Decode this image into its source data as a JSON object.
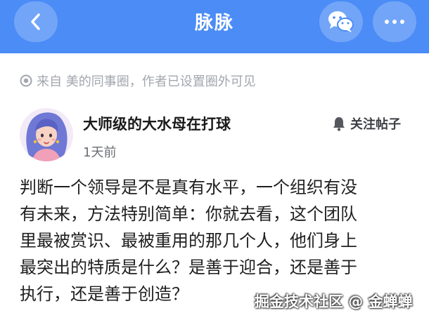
{
  "header": {
    "title": "脉脉",
    "bg_color": "#4b8cf6",
    "back_icon": "chevron-left-icon",
    "share_icon": "wechat-icon",
    "more_icon": "more-dots-icon"
  },
  "source": {
    "icon": "circle-dot-icon",
    "text": "来自 美的同事圈，作者已设置圈外可见"
  },
  "author": {
    "avatar_icon": "avatar",
    "name": "大师级的大水母在打球",
    "time": "1天前"
  },
  "follow": {
    "icon": "bell-icon",
    "label": "关注帖子"
  },
  "post": {
    "lines": [
      "判断一个领导是不是真有水平，一个组织有没",
      "有未来，方法特别简单：你就去看，这个团队",
      "里最被赏识、最被重用的那几个人，他们身上",
      "最突出的特质是什么？是善于迎合，还是善于",
      "执行，还是善于创造？"
    ]
  },
  "watermark": "掘金技术社区 @ 金蝉蝉"
}
